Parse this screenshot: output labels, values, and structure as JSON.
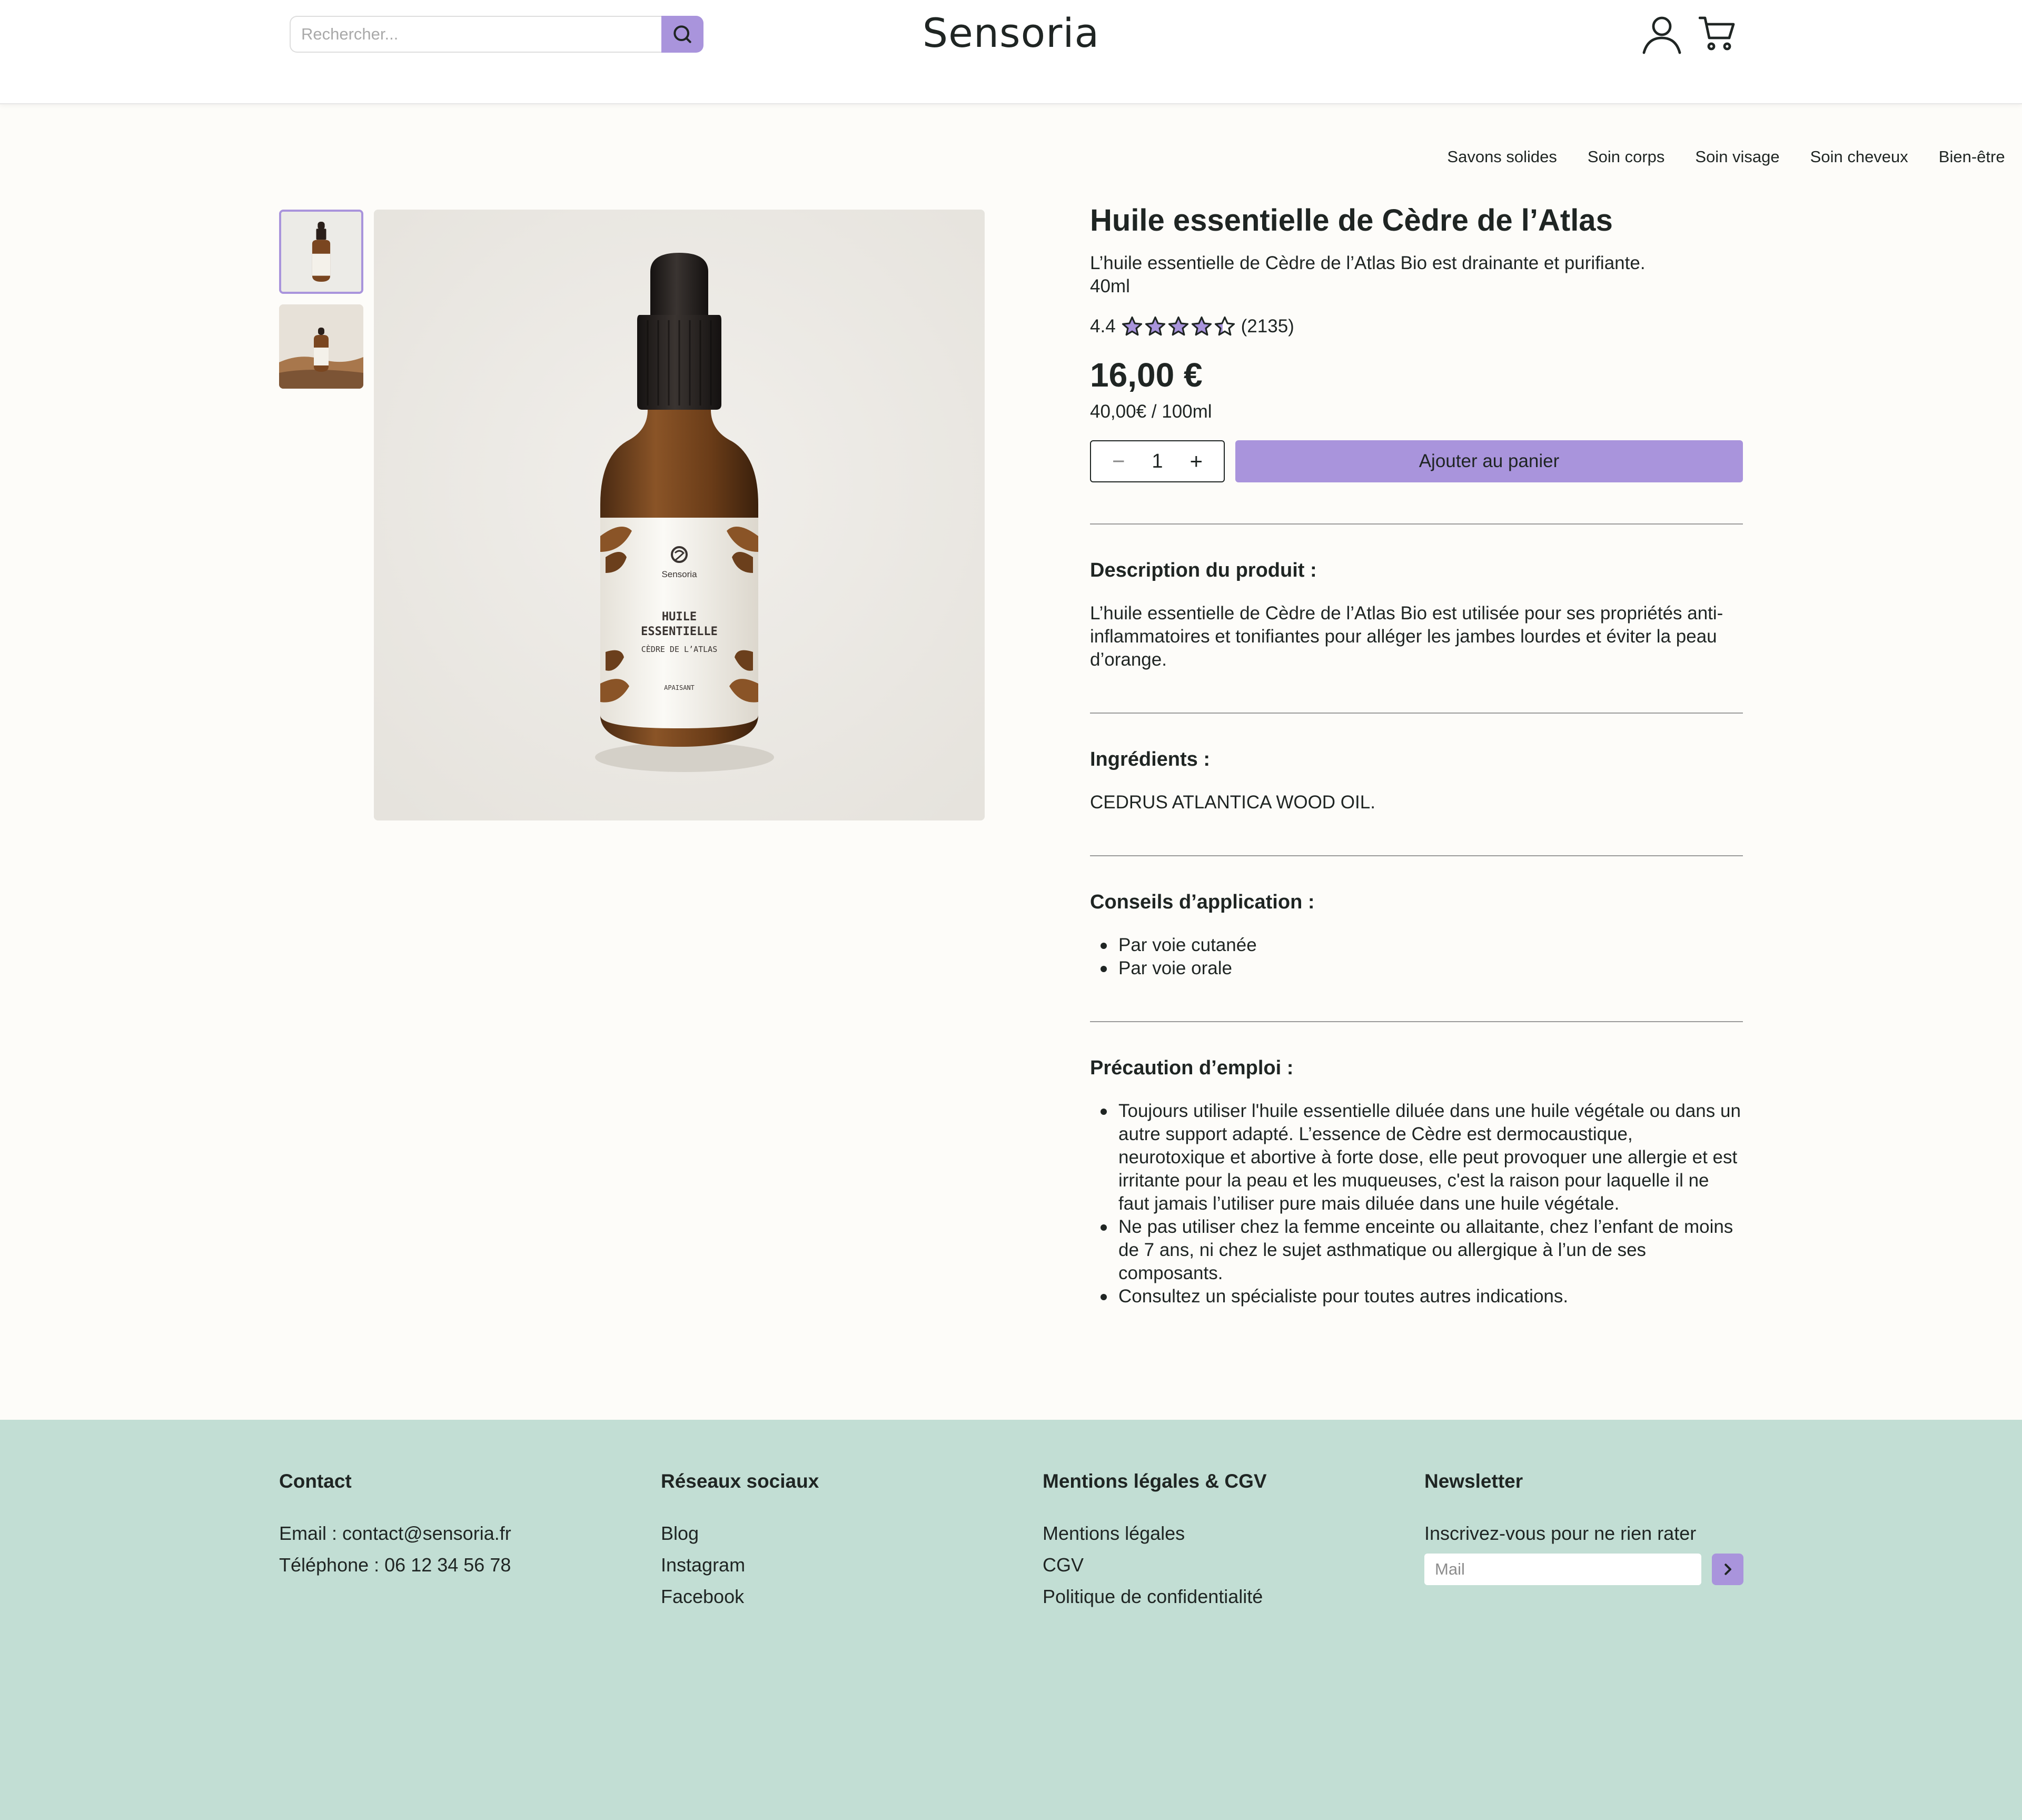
{
  "header": {
    "brand": "Sensoria",
    "search_placeholder": "Rechercher...",
    "nav": [
      "Savons solides",
      "Soin corps",
      "Soin visage",
      "Soin cheveux",
      "Bien-être"
    ]
  },
  "product": {
    "title": "Huile essentielle de Cèdre de l’Atlas",
    "subtitle": "L’huile essentielle de Cèdre de l’Atlas Bio est drainante et purifiante.",
    "size": "40ml",
    "rating_value": "4.4",
    "rating_count": "(2135)",
    "stars_filled": 4.4,
    "price": "16,00 €",
    "unit_price": "40,00€ / 100ml",
    "quantity": "1",
    "add_to_cart": "Ajouter au panier",
    "label": {
      "brand": "Sensoria",
      "line1": "HUILE",
      "line2": "ESSENTIELLE",
      "line3": "CÈDRE DE L’ATLAS",
      "line4": "APAISANT"
    }
  },
  "sections": {
    "description": {
      "title": "Description du produit :",
      "text": "L’huile essentielle de Cèdre de l’Atlas Bio est utilisée pour ses propriétés anti-inflammatoires et tonifiantes pour alléger les jambes lourdes et éviter la peau d’orange."
    },
    "ingredients": {
      "title": "Ingrédients :",
      "text": "CEDRUS ATLANTICA WOOD OIL."
    },
    "advice": {
      "title": "Conseils d’application :",
      "items": [
        "Par voie cutanée",
        "Par voie orale"
      ]
    },
    "precaution": {
      "title": "Précaution d’emploi :",
      "items": [
        "Toujours utiliser l'huile essentielle diluée dans une huile végétale ou dans un autre support adapté. L’essence de Cèdre est dermocaustique, neurotoxique et abortive à forte dose, elle peut provoquer une allergie et est irritante pour la peau et les muqueuses, c'est la raison pour laquelle il ne faut jamais l’utiliser pure mais diluée dans une huile végétale.",
        "Ne pas utiliser chez la femme enceinte ou allaitante, chez l’enfant de moins de 7 ans, ni chez le sujet asthmatique ou allergique à l’un de ses composants.",
        "Consultez un spécialiste pour toutes autres indications."
      ]
    }
  },
  "footer": {
    "contact": {
      "title": "Contact",
      "email": "Email : contact@sensoria.fr",
      "phone": "Téléphone : 06 12 34 56 78"
    },
    "social": {
      "title": "Réseaux sociaux",
      "links": [
        "Blog",
        "Instagram",
        "Facebook"
      ]
    },
    "legal": {
      "title": "Mentions légales & CGV",
      "links": [
        "Mentions légales",
        "CGV",
        "Politique de confidentialité"
      ]
    },
    "newsletter": {
      "title": "Newsletter",
      "text": "Inscrivez-vous pour ne rien rater",
      "placeholder": "Mail"
    }
  },
  "colors": {
    "accent": "#a994dc",
    "footer_bg": "#c2ded4",
    "page_bg": "#fdfcf9"
  },
  "icons": {
    "search": "search-icon",
    "user": "user-icon",
    "cart": "cart-icon",
    "star": "star-icon",
    "minus": "minus-icon",
    "plus": "plus-icon",
    "arrow": "chevron-right-icon"
  }
}
